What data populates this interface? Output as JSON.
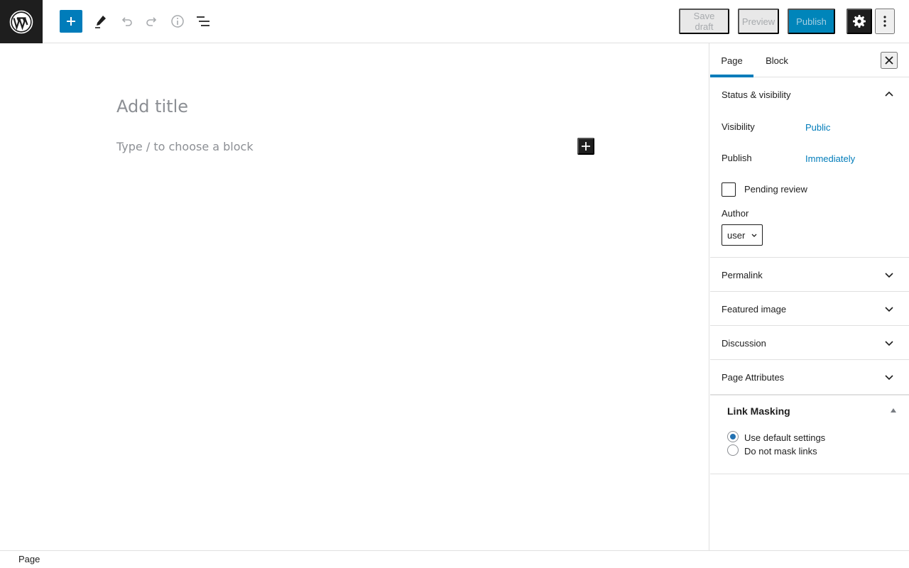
{
  "toolbar": {
    "save_draft": "Save draft",
    "preview": "Preview",
    "publish": "Publish"
  },
  "editor": {
    "title_placeholder": "Add title",
    "block_placeholder": "Type / to choose a block"
  },
  "sidebar": {
    "tabs": [
      {
        "label": "Page",
        "active": true
      },
      {
        "label": "Block",
        "active": false
      }
    ],
    "status": {
      "title": "Status & visibility",
      "visibility_label": "Visibility",
      "visibility_value": "Public",
      "publish_label": "Publish",
      "publish_value": "Immediately",
      "pending_review": "Pending review",
      "author_label": "Author",
      "author_value": "user"
    },
    "panels": [
      {
        "label": "Permalink"
      },
      {
        "label": "Featured image"
      },
      {
        "label": "Discussion"
      },
      {
        "label": "Page Attributes"
      }
    ],
    "link_masking": {
      "title": "Link Masking",
      "options": [
        {
          "label": "Use default settings",
          "checked": true
        },
        {
          "label": "Do not mask links",
          "checked": false
        }
      ]
    }
  },
  "footer": {
    "breadcrumb": "Page"
  },
  "colors": {
    "accent": "#007cba",
    "dark": "#1e1e1e",
    "placeholder": "#8c8f94",
    "border": "#e0e0e0"
  },
  "icons": {
    "logo": "wordpress-logo-icon",
    "add": "plus-icon",
    "tools": "pencil-icon",
    "undo": "undo-icon",
    "redo": "redo-icon",
    "info": "info-icon",
    "list_view": "list-view-icon",
    "settings": "gear-icon",
    "more": "more-vertical-icon",
    "close": "close-icon",
    "chevron_up": "chevron-up-icon",
    "chevron_down": "chevron-down-icon"
  }
}
